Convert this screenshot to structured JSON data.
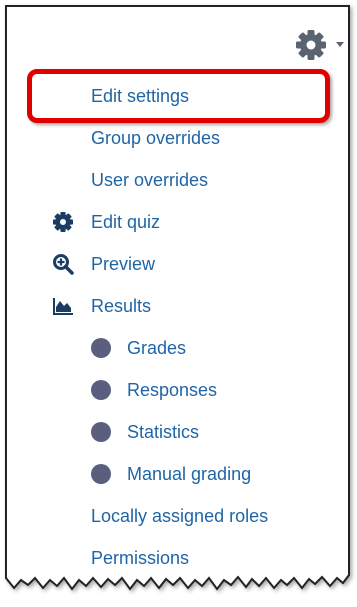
{
  "menu": {
    "trigger_icon": "gear-icon",
    "items": [
      {
        "label": "Edit settings",
        "icon": null
      },
      {
        "label": "Group overrides",
        "icon": null
      },
      {
        "label": "User overrides",
        "icon": null
      },
      {
        "label": "Edit quiz",
        "icon": "cog-icon"
      },
      {
        "label": "Preview",
        "icon": "zoom-in-icon"
      },
      {
        "label": "Results",
        "icon": "area-chart-icon"
      },
      {
        "label": "Grades",
        "icon": "bullet-icon"
      },
      {
        "label": "Responses",
        "icon": "bullet-icon"
      },
      {
        "label": "Statistics",
        "icon": "bullet-icon"
      },
      {
        "label": "Manual grading",
        "icon": "bullet-icon"
      },
      {
        "label": "Locally assigned roles",
        "icon": null
      },
      {
        "label": "Permissions",
        "icon": null
      }
    ]
  },
  "colors": {
    "link": "#1f65a6",
    "icon": "#1c3d63",
    "bullet": "#5b5f7f",
    "highlight": "#e00000",
    "frame_border": "#222222"
  }
}
